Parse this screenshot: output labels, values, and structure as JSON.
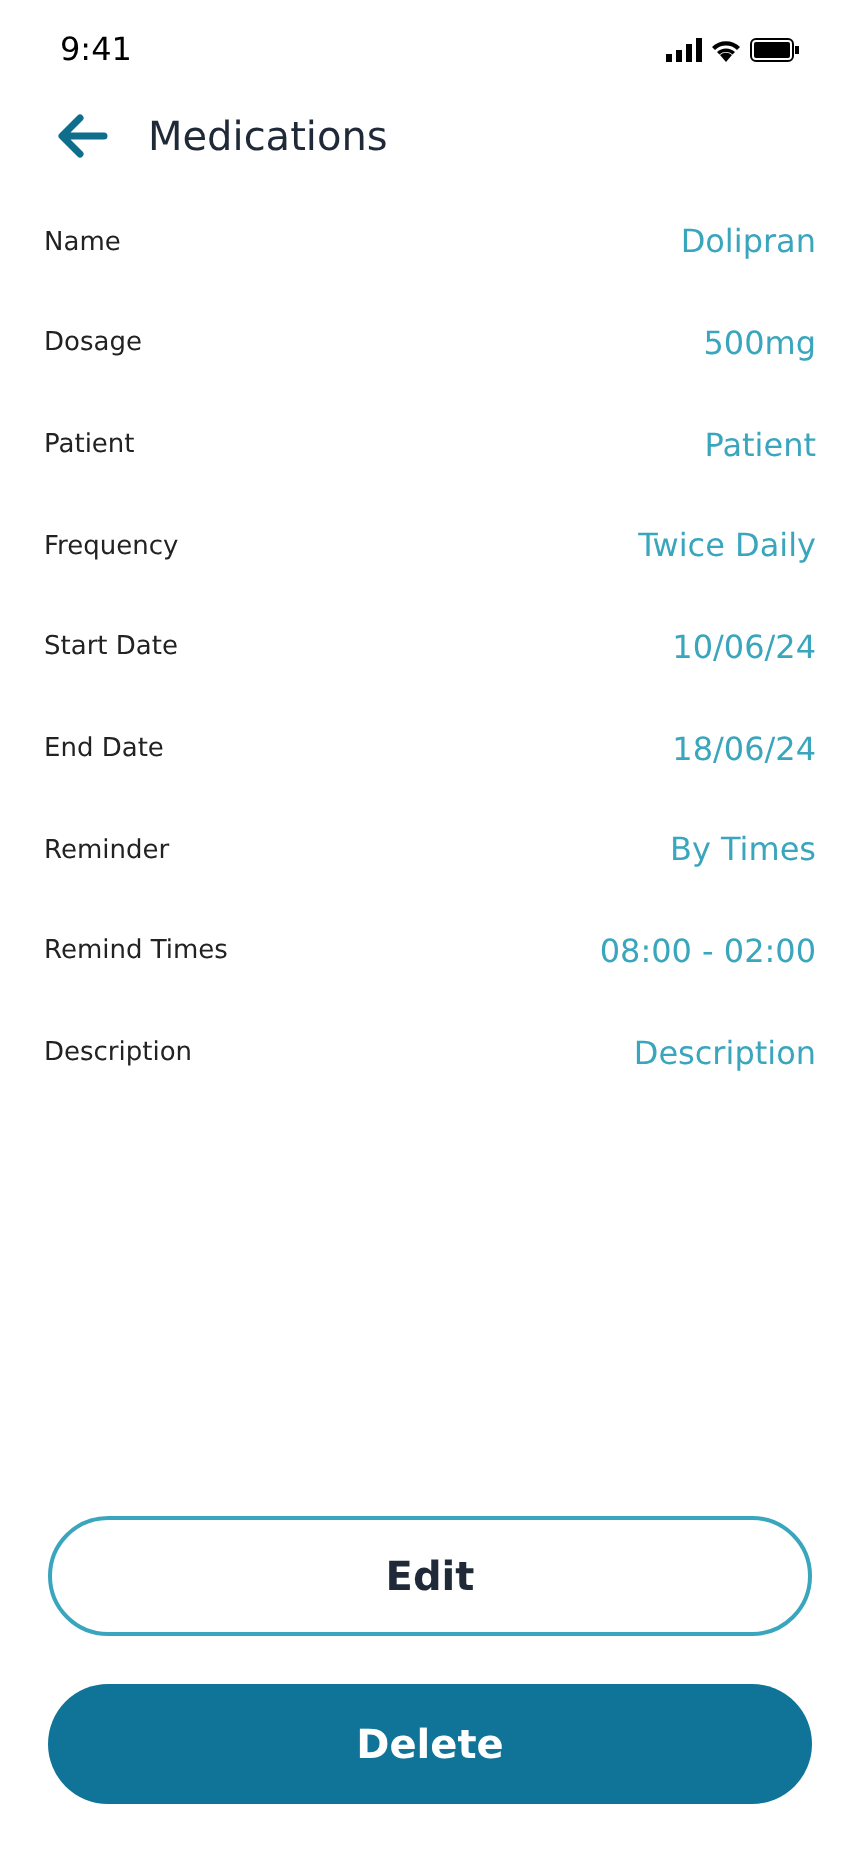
{
  "status_bar": {
    "time": "9:41"
  },
  "header": {
    "title": "Medications"
  },
  "fields": [
    {
      "label": "Name",
      "value": "Dolipran"
    },
    {
      "label": "Dosage",
      "value": "500mg"
    },
    {
      "label": "Patient",
      "value": "Patient"
    },
    {
      "label": "Frequency",
      "value": "Twice Daily"
    },
    {
      "label": "Start Date",
      "value": "10/06/24"
    },
    {
      "label": "End Date",
      "value": "18/06/24"
    },
    {
      "label": "Reminder",
      "value": "By Times"
    },
    {
      "label": "Remind Times",
      "value": "08:00 - 02:00"
    },
    {
      "label": "Description",
      "value": "Description"
    }
  ],
  "buttons": [
    {
      "label": "Edit",
      "kind": "outline"
    },
    {
      "label": "Delete",
      "kind": "filled"
    }
  ]
}
